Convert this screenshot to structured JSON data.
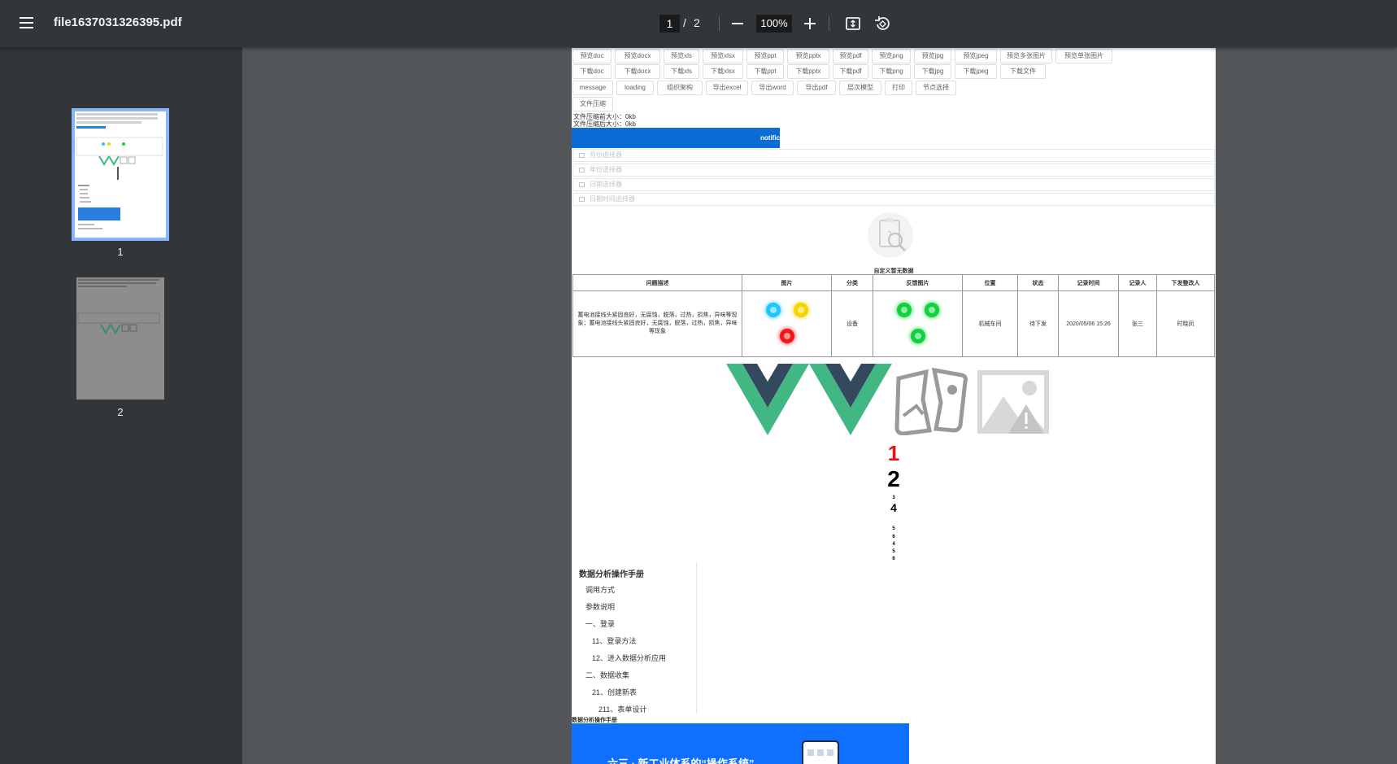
{
  "toolbar": {
    "file_name": "file1637031326395.pdf",
    "current_page": "1",
    "separator": "/",
    "total_pages": "2",
    "zoom": "100%"
  },
  "thumbnails": [
    {
      "label": "1"
    },
    {
      "label": "2"
    }
  ],
  "document": {
    "button_rows": [
      [
        "预览doc",
        "预览docx",
        "预览xls",
        "预览xlsx",
        "预览ppt",
        "预览pptx",
        "预览pdf",
        "预览png",
        "预览jpg",
        "预览jpeg",
        "预览多张图片",
        "预览单张图片"
      ],
      [
        "下载doc",
        "下载docx",
        "下载xls",
        "下载xlsx",
        "下载ppt",
        "下载pptx",
        "下载pdf",
        "下载png",
        "下载jpg",
        "下载jpeg",
        "下载文件"
      ],
      [
        "message",
        "loading",
        "组织架构",
        "导出excel",
        "导出word",
        "导出pdf",
        "层次模型",
        "打印",
        "节点选择"
      ],
      [
        "文件压缩"
      ]
    ],
    "compress_before": "文件压缩前大小：0kb",
    "compress_after": "文件压缩后大小：0kb",
    "notify_text": "notific",
    "pickers": [
      "月份选择器",
      "年份选择器",
      "日期选择器",
      "日期时间选择器"
    ],
    "empty_text": "自定义暂无数据",
    "table": {
      "headers": [
        "问题描述",
        "图片",
        "分类",
        "反馈图片",
        "位置",
        "状态",
        "记录时间",
        "记录人",
        "下发整改人"
      ],
      "row": {
        "description": "蓄电池接线头紧固良好，无腐蚀，脱落，过热，损焦，异味等现象；蓄电池接线头紧固良好，无腐蚀，脱落，过热，损焦，异味等现象",
        "category": "设备",
        "location": "机械车间",
        "status": "待下发",
        "time": "2020/05/06 15:26",
        "recorder": "张三",
        "assignee": "时晓凤"
      },
      "image_dot_colors": [
        "#1ec8ff",
        "#f5d400",
        "#f01818"
      ],
      "feedback_dot_colors": [
        "#0fd23c",
        "#0fd23c",
        "#0fd23c"
      ]
    },
    "numbers": [
      {
        "text": "1",
        "color": "#ee1111"
      },
      {
        "text": "2",
        "color": "#000000"
      },
      {
        "text": "3",
        "color": "#000000"
      },
      {
        "text": "4",
        "color": "#000000"
      },
      {
        "text": "5",
        "color": "#000000"
      },
      {
        "text": "6",
        "color": "#000000"
      },
      {
        "text": "4",
        "color": "#000000"
      },
      {
        "text": "5",
        "color": "#000000"
      },
      {
        "text": "6",
        "color": "#000000"
      }
    ],
    "toc": {
      "title": "数据分析操作手册",
      "items": [
        "调用方式",
        "参数说明",
        "一、登录",
        "11、登录方法",
        "12、进入数据分析应用",
        "二、数据收集",
        "21、创建新表",
        "211、表单设计"
      ]
    },
    "footer_title": "数据分析操作手册",
    "banner_text": "六三 · 新工业体系的“操作系统”"
  }
}
